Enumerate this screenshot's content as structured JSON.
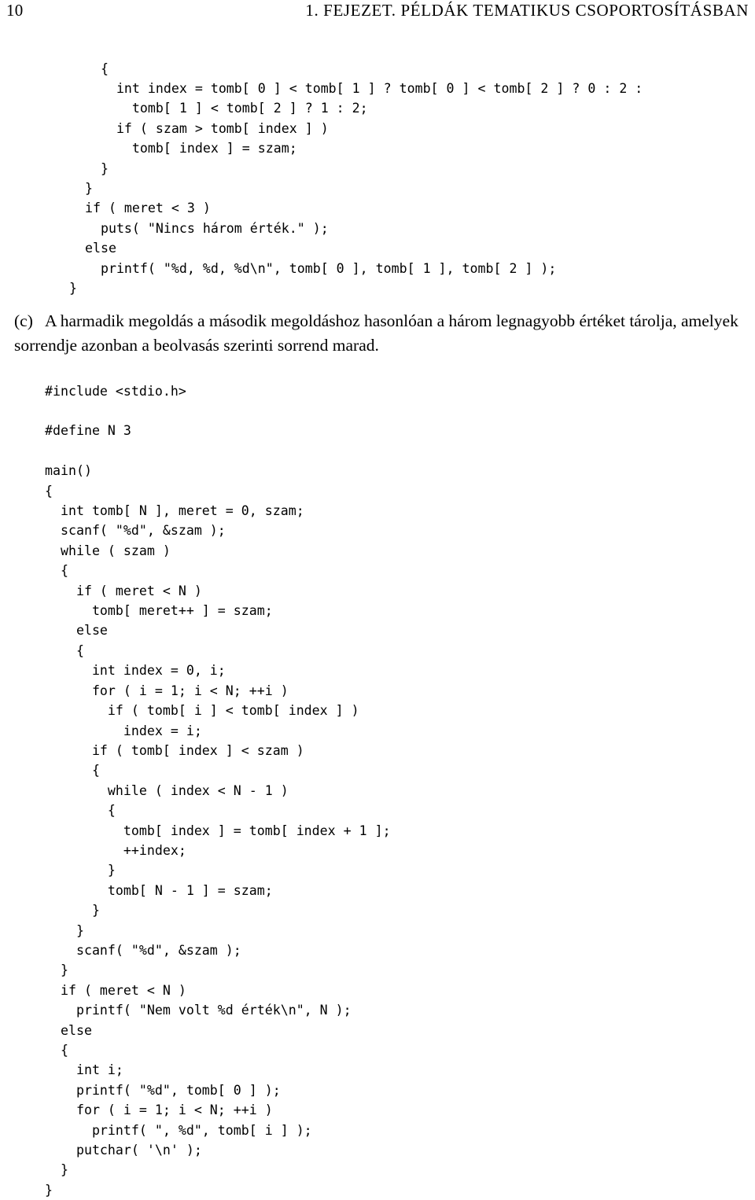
{
  "page": {
    "folio": "10",
    "running_head": "1. FEJEZET. PÉLDÁK TEMATIKUS CSOPORTOSÍTÁSBAN"
  },
  "code_top": {
    "language": "c",
    "text": "    {\n      int index = tomb[ 0 ] < tomb[ 1 ] ? tomb[ 0 ] < tomb[ 2 ] ? 0 : 2 :\n        tomb[ 1 ] < tomb[ 2 ] ? 1 : 2;\n      if ( szam > tomb[ index ] )\n        tomb[ index ] = szam;\n    }\n  }\n  if ( meret < 3 )\n    puts( \"Nincs három érték.\" );\n  else\n    printf( \"%d, %d, %d\\n\", tomb[ 0 ], tomb[ 1 ], tomb[ 2 ] );\n}"
  },
  "list_item": {
    "marker": "(c)",
    "text": "A harmadik megoldás a második megoldáshoz hasonlóan a három legnagyobb értéket tárolja, amelyek sorrendje azonban a beolvasás szerinti sorrend marad."
  },
  "code_main": {
    "language": "c",
    "text": "#include <stdio.h>\n\n#define N 3\n\nmain()\n{\n  int tomb[ N ], meret = 0, szam;\n  scanf( \"%d\", &szam );\n  while ( szam )\n  {\n    if ( meret < N )\n      tomb[ meret++ ] = szam;\n    else\n    {\n      int index = 0, i;\n      for ( i = 1; i < N; ++i )\n        if ( tomb[ i ] < tomb[ index ] )\n          index = i;\n      if ( tomb[ index ] < szam )\n      {\n        while ( index < N - 1 )\n        {\n          tomb[ index ] = tomb[ index + 1 ];\n          ++index;\n        }\n        tomb[ N - 1 ] = szam;\n      }\n    }\n    scanf( \"%d\", &szam );\n  }\n  if ( meret < N )\n    printf( \"Nem volt %d érték\\n\", N );\n  else\n  {\n    int i;\n    printf( \"%d\", tomb[ 0 ] );\n    for ( i = 1; i < N; ++i )\n      printf( \", %d\", tomb[ i ] );\n    putchar( '\\n' );\n  }\n}"
  }
}
